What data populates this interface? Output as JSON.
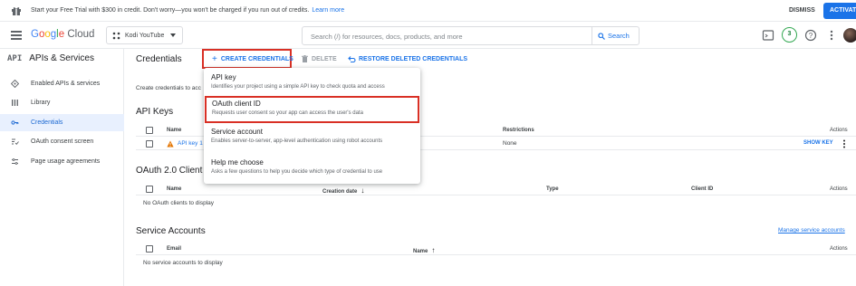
{
  "banner": {
    "message": "Start your Free Trial with $300 in credit. Don't worry—you won't be charged if you run out of credits.",
    "learn_more": "Learn more",
    "dismiss": "DISMISS",
    "activate": "ACTIVATE"
  },
  "topbar": {
    "project": "Kodi YouTube",
    "search_placeholder": "Search (/) for resources, docs, products, and more",
    "search_button": "Search",
    "notification_count": "3"
  },
  "logo": {
    "google": [
      "G",
      "o",
      "o",
      "g",
      "l",
      "e"
    ],
    "cloud": "Cloud"
  },
  "nav": {
    "api_badge": "API",
    "title": "APIs & Services",
    "items": [
      {
        "label": "Enabled APIs & services",
        "icon": "diamond-grid-icon"
      },
      {
        "label": "Library",
        "icon": "library-icon"
      },
      {
        "label": "Credentials",
        "icon": "key-icon",
        "active": true
      },
      {
        "label": "OAuth consent screen",
        "icon": "consent-icon"
      },
      {
        "label": "Page usage agreements",
        "icon": "settings-list-icon"
      }
    ]
  },
  "actions": {
    "page_title": "Credentials",
    "create": "CREATE CREDENTIALS",
    "delete": "DELETE",
    "restore": "RESTORE DELETED CREDENTIALS"
  },
  "intro": "Create credentials to acc",
  "api_keys": {
    "title": "API Keys",
    "columns": {
      "name": "Name",
      "restrictions": "Restrictions",
      "actions": "Actions"
    },
    "row": {
      "name": "API key 1",
      "restrictions": "None",
      "action": "SHOW KEY"
    }
  },
  "oauth": {
    "title": "OAuth 2.0 Client I",
    "columns": {
      "name": "Name",
      "creation_date": "Creation date",
      "type": "Type",
      "client_id": "Client ID",
      "actions": "Actions"
    },
    "empty": "No OAuth clients to display"
  },
  "service_accounts": {
    "title": "Service Accounts",
    "manage": "Manage service accounts",
    "columns": {
      "email": "Email",
      "name": "Name",
      "actions": "Actions"
    },
    "empty": "No service accounts to display"
  },
  "menu": {
    "items": [
      {
        "title": "API key",
        "desc": "Identifies your project using a simple API key to check quota and access"
      },
      {
        "title": "OAuth client ID",
        "desc": "Requests user consent so your app can access the user's data"
      },
      {
        "title": "Service account",
        "desc": "Enables server-to-server, app-level authentication using robot accounts"
      },
      {
        "title": "Help me choose",
        "desc": "Asks a few questions to help you decide which type of credential to use"
      }
    ]
  },
  "colors": {
    "accent": "#1a73e8",
    "highlight_border": "#d93025",
    "active_nav_bg": "#e8f0fe"
  }
}
